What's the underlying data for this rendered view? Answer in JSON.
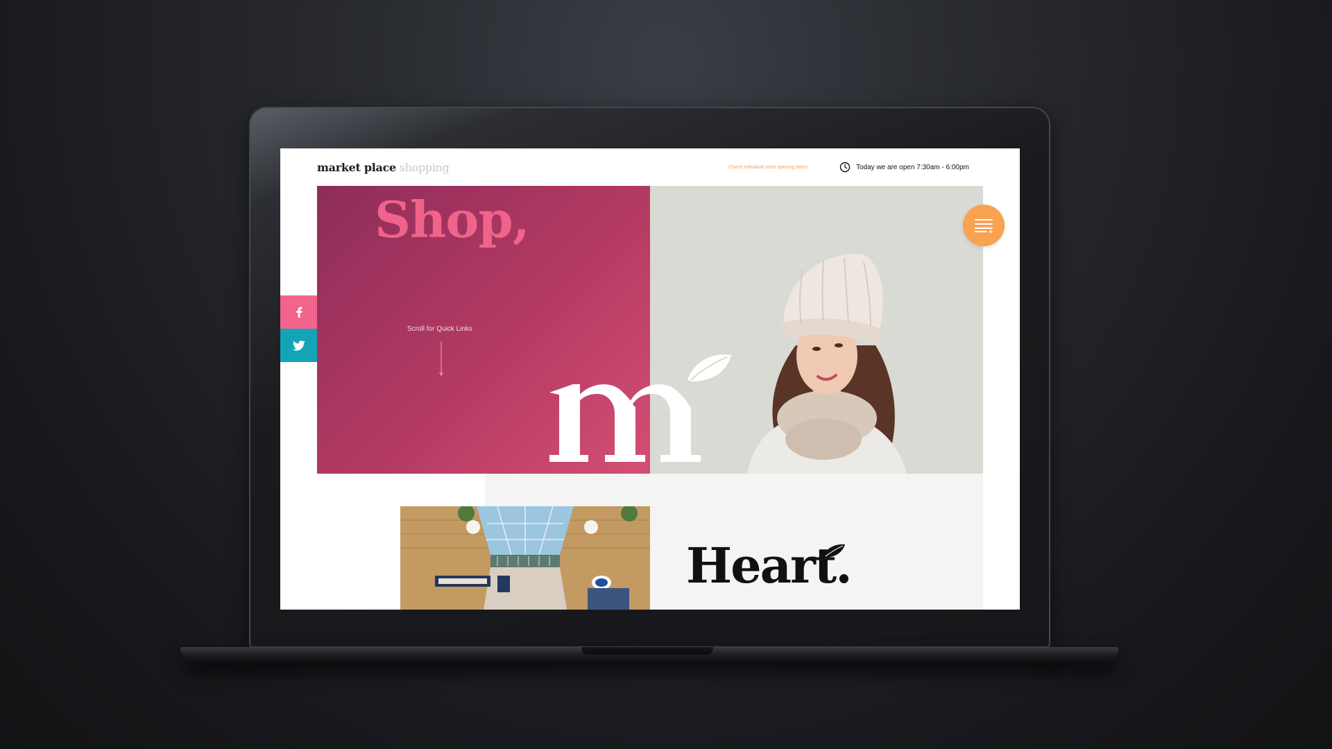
{
  "header": {
    "logo_primary": "market place",
    "logo_secondary": "shopping",
    "opening_times_link": "Check individual store opening times",
    "open_hours": "Today we are open 7:30am - 6:00pm"
  },
  "hero": {
    "headline": "Shop,",
    "scroll_label": "Scroll for Quick Links"
  },
  "social": {
    "facebook_label": "f",
    "icons": [
      "facebook-icon",
      "twitter-icon"
    ]
  },
  "menu": {
    "icon": "hamburger-menu-icon"
  },
  "section2": {
    "title": "Heart."
  },
  "colors": {
    "hero_pink": "#b43a63",
    "headline_pink": "#f0638a",
    "accent_orange": "#f9a24f",
    "facebook_pink": "#f3648c",
    "twitter_teal": "#13a4b6"
  }
}
